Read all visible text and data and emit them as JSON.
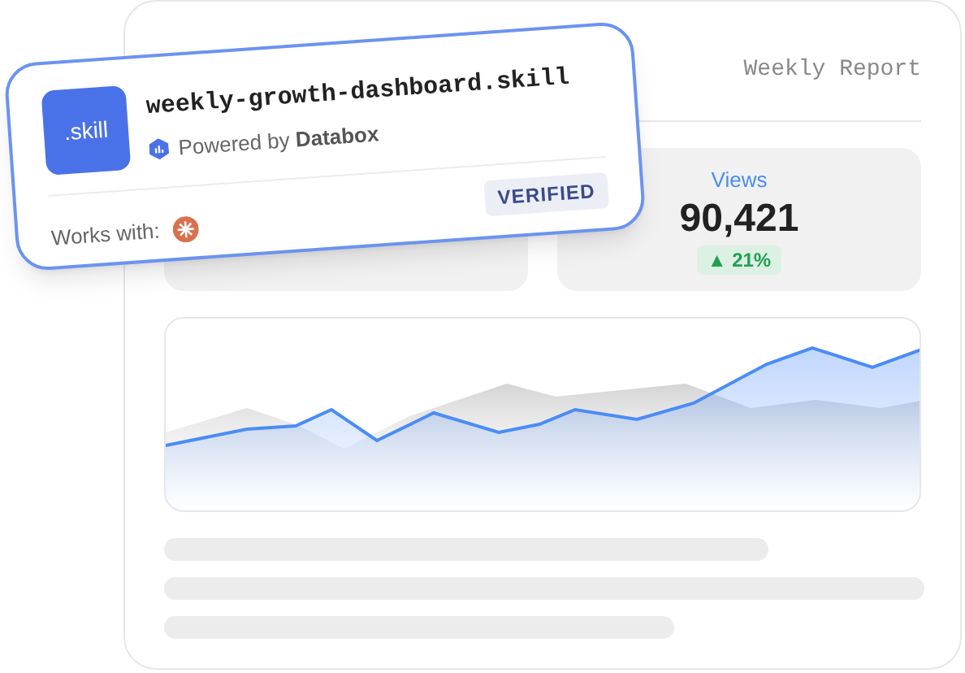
{
  "report": {
    "title": "Weekly Report"
  },
  "stats": [
    {
      "label": "Views",
      "value": "90,421",
      "change": "▲ 21%"
    }
  ],
  "skill_card": {
    "badge": ".skill",
    "filename": "weekly-growth-dashboard.skill",
    "powered_prefix": "Powered by",
    "powered_brand": "Databox",
    "works_with": "Works with:",
    "status": "VERIFIED"
  }
}
